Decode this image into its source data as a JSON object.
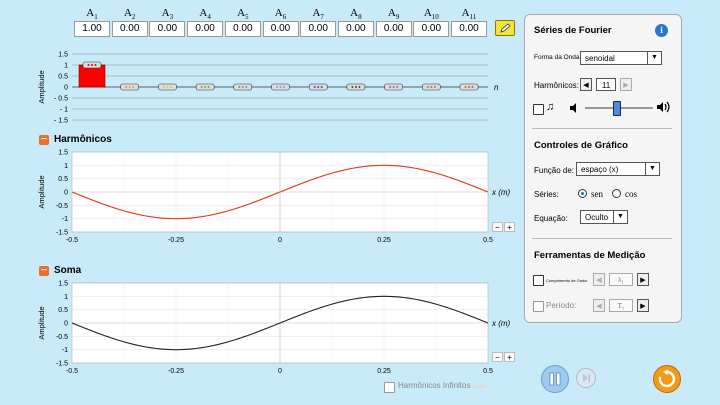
{
  "amplitudes": {
    "labels": [
      [
        "A",
        "1"
      ],
      [
        "A",
        "2"
      ],
      [
        "A",
        "3"
      ],
      [
        "A",
        "4"
      ],
      [
        "A",
        "5"
      ],
      [
        "A",
        "6"
      ],
      [
        "A",
        "7"
      ],
      [
        "A",
        "8"
      ],
      [
        "A",
        "9"
      ],
      [
        "A",
        "10"
      ],
      [
        "A",
        "11"
      ]
    ],
    "values": [
      "1.00",
      "0.00",
      "0.00",
      "0.00",
      "0.00",
      "0.00",
      "0.00",
      "0.00",
      "0.00",
      "0.00",
      "0.00"
    ],
    "ylabel": "Amplitude",
    "n_label": "n",
    "ticks": [
      "1.5",
      "1",
      "0.5",
      "0",
      "- 0.5",
      "- 1",
      "- 1.5"
    ]
  },
  "harmonics_section": {
    "title": "Harmônicos",
    "ylabel": "Amplitude",
    "xlabel": "x (m)",
    "yticks": [
      "1.5",
      "1",
      "0.5",
      "0",
      "-0.5",
      "-1",
      "-1.5"
    ],
    "xticks": [
      "-0.5",
      "-0.25",
      "0",
      "0.25",
      "0.5"
    ],
    "zoom_out": "−",
    "zoom_in": "+"
  },
  "sum_section": {
    "title": "Soma",
    "ylabel": "Amplitude",
    "xlabel": "x (m)",
    "yticks": [
      "1.5",
      "1",
      "0.5",
      "0",
      "-0.5",
      "-1",
      "-1.5"
    ],
    "xticks": [
      "-0.5",
      "-0.25",
      "0",
      "0.25",
      "0.5"
    ],
    "zoom_out": "−",
    "zoom_in": "+",
    "infinite_label": "Harmônicos Infinitos"
  },
  "panel": {
    "fourier_title": "Séries de Fourier",
    "info": "i",
    "waveform_label": "Forma da Onda:",
    "waveform_value": "senoidal",
    "harmonics_label": "Harmônicos:",
    "harmonics_value": "11",
    "graph_title": "Controles de Gráfico",
    "function_label": "Função de:",
    "function_value": "espaço (x)",
    "series_label": "Séries:",
    "series_sin": "sen",
    "series_cos": "cos",
    "equation_label": "Equação:",
    "equation_value": "Oculto",
    "tools_title": "Ferramentas de Medição",
    "wavelength_label": "Comprimento de Onda:",
    "wavelength_value": "λ₁",
    "period_label": "Período:",
    "period_value": "T₁"
  },
  "chart_data": [
    {
      "type": "bar",
      "categories": [
        "1",
        "2",
        "3",
        "4",
        "5",
        "6",
        "7",
        "8",
        "9",
        "10",
        "11"
      ],
      "values": [
        1,
        0,
        0,
        0,
        0,
        0,
        0,
        0,
        0,
        0,
        0
      ],
      "ylabel": "Amplitude",
      "xlabel": "n",
      "ylim": [
        -1.5,
        1.5
      ]
    },
    {
      "type": "line",
      "title": "Harmônicos",
      "ylabel": "Amplitude",
      "xlabel": "x (m)",
      "xlim": [
        -0.5,
        0.5
      ],
      "ylim": [
        -1.5,
        1.5
      ],
      "series": [
        {
          "color": "#e8321e",
          "function": "sin(2πx)",
          "x": [
            -0.5,
            -0.375,
            -0.25,
            -0.125,
            0,
            0.125,
            0.25,
            0.375,
            0.5
          ],
          "values": [
            0,
            -0.707,
            -1,
            -0.707,
            0,
            0.707,
            1,
            0.707,
            0
          ]
        }
      ]
    },
    {
      "type": "line",
      "title": "Soma",
      "ylabel": "Amplitude",
      "xlabel": "x (m)",
      "xlim": [
        -0.5,
        0.5
      ],
      "ylim": [
        -1.5,
        1.5
      ],
      "series": [
        {
          "color": "#222222",
          "function": "sin(2πx)",
          "x": [
            -0.5,
            -0.375,
            -0.25,
            -0.125,
            0,
            0.125,
            0.25,
            0.375,
            0.5
          ],
          "values": [
            0,
            -0.707,
            -1,
            -0.707,
            0,
            0.707,
            1,
            0.707,
            0
          ]
        }
      ]
    }
  ],
  "colors": {
    "background": "#c9eaf8",
    "bar": "#ff0000",
    "harmonic": "#e8321e",
    "accent": "#e8702a",
    "reset": "#f39a1a",
    "play": "#9ec9f0"
  },
  "icons": [
    "pencil-icon",
    "info-icon",
    "note-icon",
    "speaker-low-icon",
    "speaker-high-icon",
    "pause-icon",
    "step-icon",
    "reset-icon",
    "left-arrow-icon",
    "right-arrow-icon"
  ]
}
